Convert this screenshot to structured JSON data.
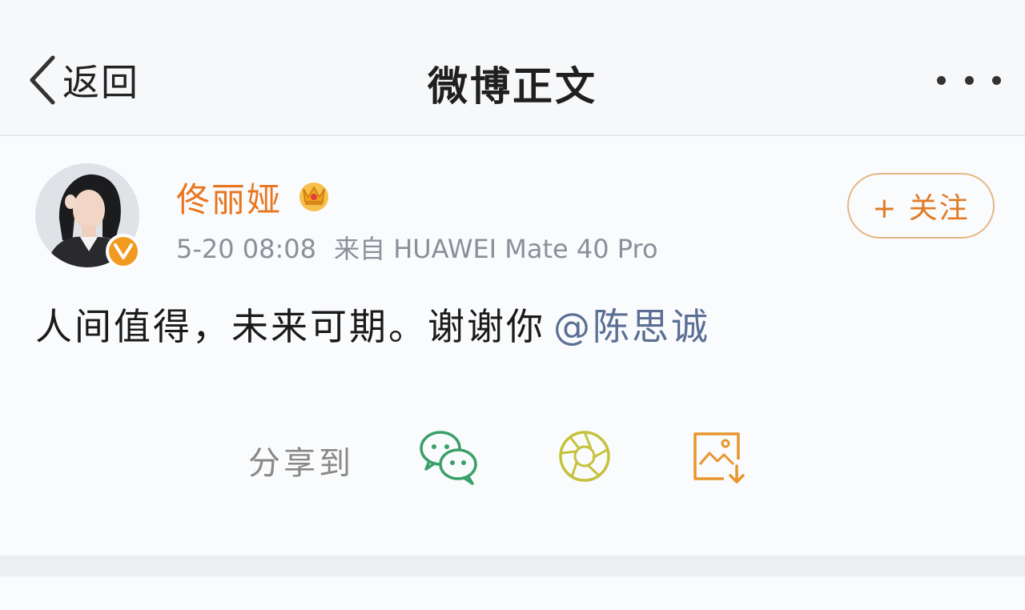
{
  "nav": {
    "back_label": "返回",
    "title": "微博正文"
  },
  "post": {
    "user_name": "佟丽娅",
    "time": "5-20 08:08",
    "source": "来自 HUAWEI Mate 40 Pro",
    "follow_label": "+ 关注",
    "text": "人间值得，未来可期。谢谢你",
    "mention": "@陈思诚"
  },
  "share": {
    "label": "分享到",
    "icons": [
      "wechat-icon",
      "moments-icon",
      "save-image-icon"
    ]
  },
  "colors": {
    "username": "#e8761f",
    "follow_border": "#e3b883",
    "mention": "#5b6e94",
    "wechat_green": "#3aa06a",
    "moments_yellow": "#c4c23a",
    "save_orange": "#e8962e"
  }
}
